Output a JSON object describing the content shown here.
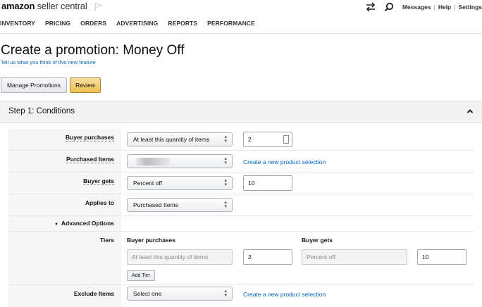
{
  "header": {
    "logo_brand": "amazon",
    "logo_rest": "seller central",
    "links": [
      "Messages",
      "Help",
      "Settings"
    ],
    "separator": "|"
  },
  "nav": [
    "INVENTORY",
    "PRICING",
    "ORDERS",
    "ADVERTISING",
    "REPORTS",
    "PERFORMANCE"
  ],
  "page": {
    "title": "Create a promotion: Money Off",
    "feedback_link": "Tell us what you think of this new feature"
  },
  "buttons": {
    "manage": "Manage Promotions",
    "review": "Review"
  },
  "step": {
    "title": "Step 1: Conditions"
  },
  "form": {
    "buyer_purchases": {
      "label": "Buyer purchases",
      "select": "At least this quantity of items",
      "value": "2"
    },
    "purchased_items": {
      "label": "Purchased Items",
      "link": "Create a new product selection"
    },
    "buyer_gets": {
      "label": "Buyer gets",
      "select": "Percent off",
      "value": "10"
    },
    "applies_to": {
      "label": "Applies to",
      "select": "Purchased Items"
    },
    "advanced_options": "Advanced Options",
    "tiers": {
      "label": "Tiers",
      "col_purchases": "Buyer purchases",
      "col_gets": "Buyer gets",
      "purchases_placeholder": "At least this quantity of items",
      "purchases_value": "2",
      "gets_placeholder": "Percent off",
      "gets_value": "10",
      "add_tier": "Add Tier"
    },
    "exclude_items": {
      "label": "Exclude Items",
      "select": "Select one",
      "link": "Create a new product selection"
    }
  },
  "colors": {
    "link": "#0066c0",
    "review_button": "#f0c14b",
    "step_header_bg": "#f3f3f3"
  },
  "icons": [
    "flag-icon",
    "swap-arrows-icon",
    "search-icon",
    "chevron-up-icon",
    "select-arrows-icon",
    "triangle-down-icon"
  ]
}
